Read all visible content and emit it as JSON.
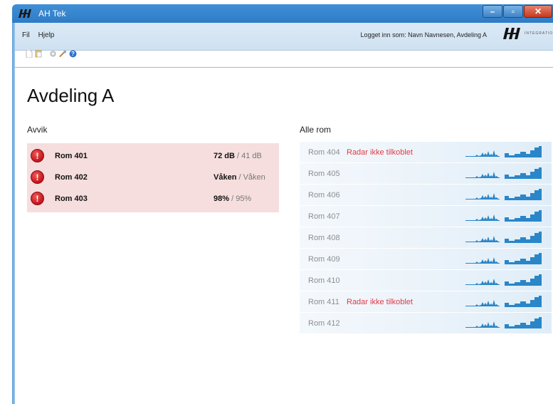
{
  "window": {
    "title": "AH Tek",
    "buttons": {
      "minimize": "–",
      "maximize": "▫",
      "close": "✕"
    }
  },
  "menu": {
    "items": [
      "Fil",
      "Hjelp"
    ],
    "logged_in": "Logget inn som: Navn Navnesen, Avdeling A",
    "brand_text": "INTEGRATION SOLUTION"
  },
  "toolbar": {
    "icons": [
      "new-document-icon",
      "open-document-icon",
      "settings-icon",
      "tools-icon",
      "help-icon"
    ]
  },
  "page": {
    "title": "Avdeling A",
    "avvik_title": "Avvik",
    "alle_rom_title": "Alle rom"
  },
  "avvik": [
    {
      "room": "Rom 401",
      "value": "72 dB",
      "ref": " / 41 dB"
    },
    {
      "room": "Rom 402",
      "value": "Våken",
      "ref": " / Våken"
    },
    {
      "room": "Rom 403",
      "value": "98%",
      "ref": " / 95%"
    }
  ],
  "rooms": [
    {
      "name": "Rom 404",
      "alert": "Radar ikke tilkoblet"
    },
    {
      "name": "Rom 405",
      "alert": ""
    },
    {
      "name": "Rom 406",
      "alert": ""
    },
    {
      "name": "Rom 407",
      "alert": ""
    },
    {
      "name": "Rom 408",
      "alert": ""
    },
    {
      "name": "Rom 409",
      "alert": ""
    },
    {
      "name": "Rom 410",
      "alert": ""
    },
    {
      "name": "Rom 411",
      "alert": "Radar ikke tilkoblet"
    },
    {
      "name": "Rom 412",
      "alert": ""
    }
  ],
  "colors": {
    "accent": "#2f7cc6",
    "alert": "#e03a48",
    "avvik_bg": "#f6dede",
    "chart": "#2a86c8"
  }
}
